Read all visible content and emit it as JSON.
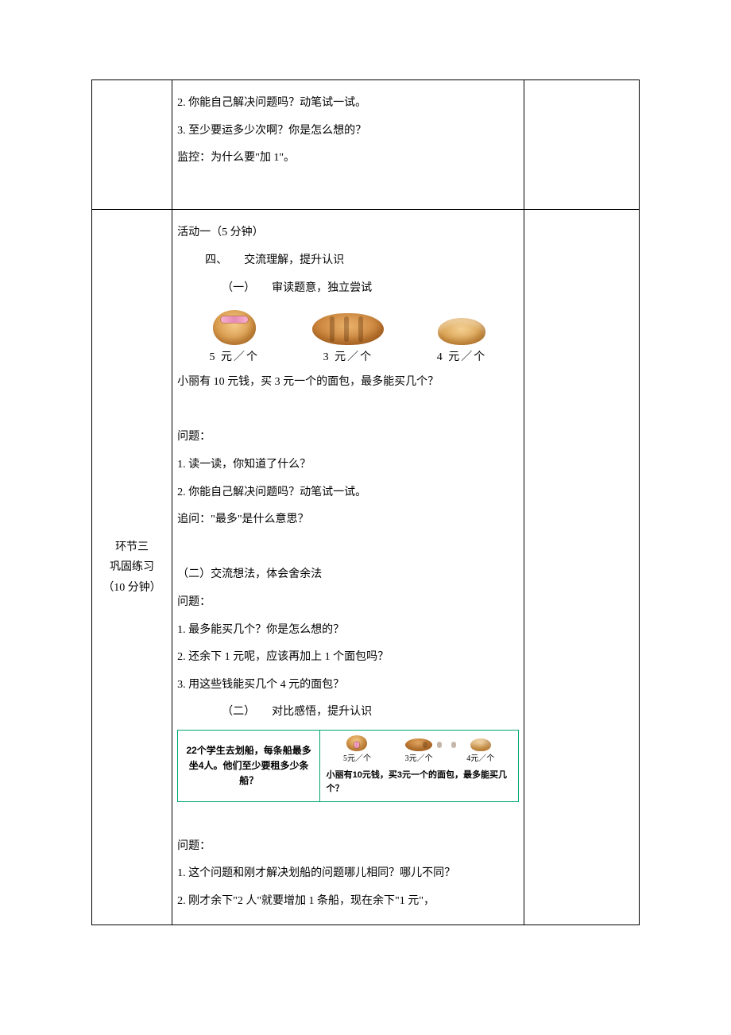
{
  "row1": {
    "p1": "2. 你能自己解决问题吗？动笔试一试。",
    "p2": "3. 至少要运多少次啊？你是怎么想的？",
    "p3": "监控：为什么要\"加 1\"。"
  },
  "stage3": {
    "label_line1": "环节三",
    "label_line2": "巩固练习",
    "label_line3": "（10 分钟）"
  },
  "body3": {
    "act_title": "活动一（5 分钟）",
    "h4": "四、　　交流理解，提升认识",
    "h4a": "（一）　　审读题意，独立尝试",
    "bread": {
      "p1": "5 元／个",
      "p2": "3 元／个",
      "p3": "4 元／个"
    },
    "q_context": "小丽有 10 元钱，买 3 元一个的面包，最多能买几个？",
    "qh1": "问题：",
    "q1": "1. 读一读，你知道了什么？",
    "q2": "2. 你能自己解决问题吗？动笔试一试。",
    "q3": "追问：\"最多\"是什么意思？",
    "h4b": "（二）交流想法，体会舍余法",
    "qh2": "问题：",
    "b1": "1. 最多能买几个？你是怎么想的？",
    "b2": "2. 还余下 1 元呢，应该再加上 1 个面包吗？",
    "b3": "3. 用这些钱能买几个 4 元的面包？",
    "h4c": "（二）　　对比感悟，提升认识",
    "compare": {
      "left_l1": "22个学生去划船，每条船最多",
      "left_l2": "坐4人。他们至少要租多少条船？",
      "mini": {
        "p1": "5元／个",
        "p2": "3元／个",
        "p3": "4元／个"
      },
      "right_q": "小丽有10元钱，买3元一个的面包，最多能买几个？"
    },
    "qh3": "问题：",
    "c1": "1. 这个问题和刚才解决划船的问题哪儿相同？哪儿不同？",
    "c2": "2. 刚才余下\"2 人\"就要增加 1 条船，现在余下\"1 元\"，"
  }
}
